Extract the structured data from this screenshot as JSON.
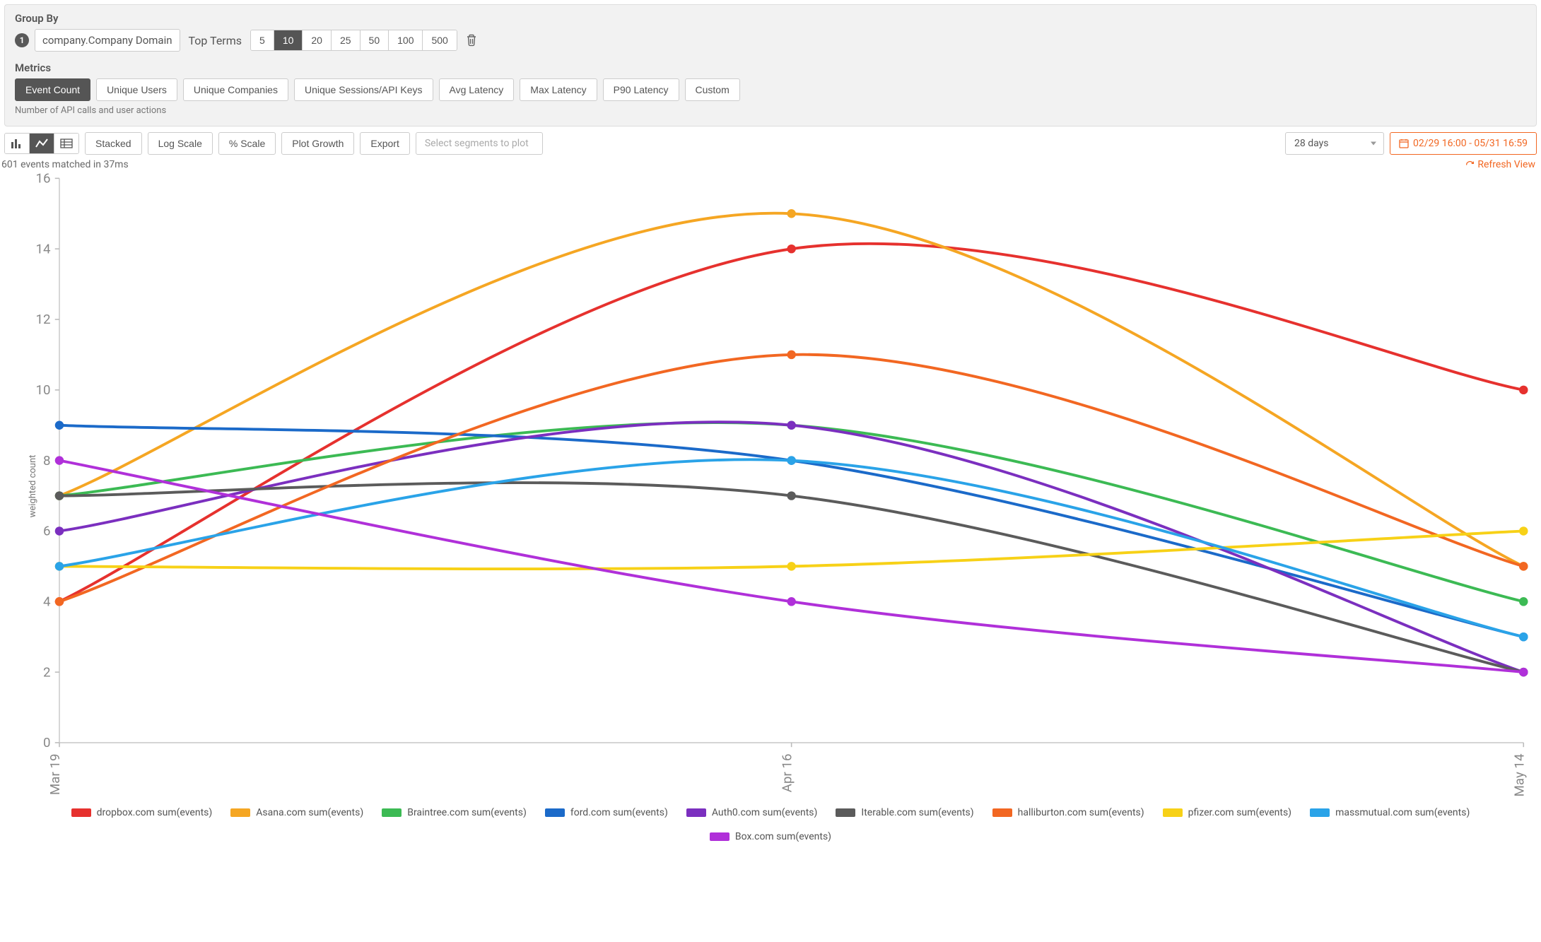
{
  "groupBy": {
    "label": "Group By",
    "badge": "1",
    "field": "company.Company Domain",
    "topTermsLabel": "Top Terms",
    "termOptions": [
      "5",
      "10",
      "20",
      "25",
      "50",
      "100",
      "500"
    ],
    "termSelected": "10"
  },
  "metrics": {
    "label": "Metrics",
    "options": [
      "Event Count",
      "Unique Users",
      "Unique Companies",
      "Unique Sessions/API Keys",
      "Avg Latency",
      "Max Latency",
      "P90 Latency",
      "Custom"
    ],
    "selected": "Event Count",
    "helper": "Number of API calls and user actions"
  },
  "toolbar": {
    "viewModes": [
      "bar",
      "line",
      "table"
    ],
    "viewModeSelected": "line",
    "buttons": {
      "stacked": "Stacked",
      "logScale": "Log Scale",
      "pctScale": "% Scale",
      "plotGrowth": "Plot Growth",
      "export": "Export"
    },
    "segmentsPlaceholder": "Select segments to plot",
    "periodSelected": "28 days",
    "dateRange": "02/29 16:00 - 05/31 16:59"
  },
  "status": {
    "matched": "601 events matched in 37ms",
    "refresh": "Refresh View"
  },
  "chart_data": {
    "type": "line",
    "ylabel": "weighted count",
    "xlabel": "",
    "categories": [
      "Mar 19",
      "Apr 16",
      "May 14"
    ],
    "ylim": [
      0,
      16
    ],
    "yticks": [
      0,
      2,
      4,
      6,
      8,
      10,
      12,
      14,
      16
    ],
    "series": [
      {
        "name": "dropbox.com sum(events)",
        "color": "#e6312e",
        "values": [
          4,
          14,
          10
        ]
      },
      {
        "name": "Asana.com sum(events)",
        "color": "#f5a623",
        "values": [
          7,
          15,
          5
        ]
      },
      {
        "name": "Braintree.com sum(events)",
        "color": "#3cba54",
        "values": [
          7,
          9,
          4
        ]
      },
      {
        "name": "ford.com sum(events)",
        "color": "#1b6ac9",
        "values": [
          9,
          8,
          3
        ]
      },
      {
        "name": "Auth0.com sum(events)",
        "color": "#7b2fbf",
        "values": [
          6,
          9,
          2
        ]
      },
      {
        "name": "Iterable.com sum(events)",
        "color": "#5b5b5b",
        "values": [
          7,
          7,
          2
        ]
      },
      {
        "name": "halliburton.com sum(events)",
        "color": "#f26722",
        "values": [
          4,
          11,
          5
        ]
      },
      {
        "name": "pfizer.com sum(events)",
        "color": "#f7d117",
        "values": [
          5,
          5,
          6
        ]
      },
      {
        "name": "massmutual.com sum(events)",
        "color": "#2aa3e8",
        "values": [
          5,
          8,
          3
        ]
      },
      {
        "name": "Box.com sum(events)",
        "color": "#b030d9",
        "values": [
          8,
          4,
          2
        ]
      }
    ]
  }
}
